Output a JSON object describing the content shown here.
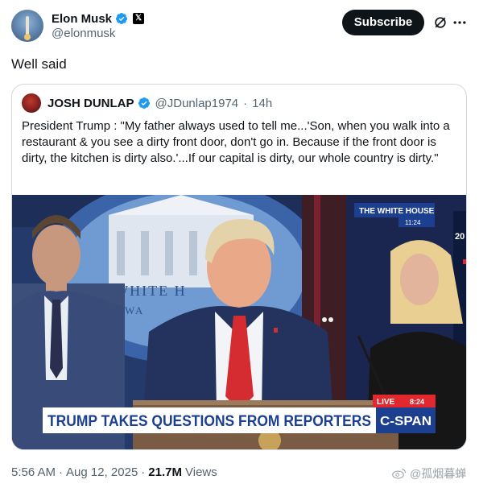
{
  "author": {
    "name": "Elon Musk",
    "handle": "@elonmusk",
    "verified": true,
    "affiliate_icon": "x-logo-icon"
  },
  "actions": {
    "subscribe_label": "Subscribe",
    "grok_icon": "grok-icon",
    "more_icon": "more-icon"
  },
  "post": {
    "text": "Well said"
  },
  "quoted": {
    "name": "JOSH DUNLAP",
    "handle": "@JDunlap1974",
    "separator": "·",
    "time": "14h",
    "text": "President Trump : \"My father always used to tell me...'Son, when you walk into a restaurant & you see a dirty front door, don't go in. Because if the front door is dirty, the kitchen is dirty also.'...If our capital is dirty, our whole country is dirty.\"",
    "media": {
      "tv_channel": "THE WHITE HOUSE",
      "tv_time": "11:24",
      "live_label": "LIVE",
      "live_time": "8:24",
      "lower_third": "TRUMP TAKES QUESTIONS FROM REPORTERS",
      "network_logo": "C-SPAN",
      "backdrop_text_1": "THE WHITE H",
      "backdrop_text_2": "WA",
      "side_number": "20"
    }
  },
  "meta": {
    "time": "5:56 AM",
    "dot1": "·",
    "date": "Aug 12, 2025",
    "dot2": "·",
    "views_count": "21.7M",
    "views_label": "Views"
  },
  "watermark": {
    "text": "@孤烟暮蝉"
  },
  "colors": {
    "verified_blue": "#1d9bf0",
    "text": "#0f1419",
    "secondary": "#536471",
    "border": "#cfd9de",
    "cspan_blue": "#1d3f8f",
    "live_red": "#e0282e"
  }
}
